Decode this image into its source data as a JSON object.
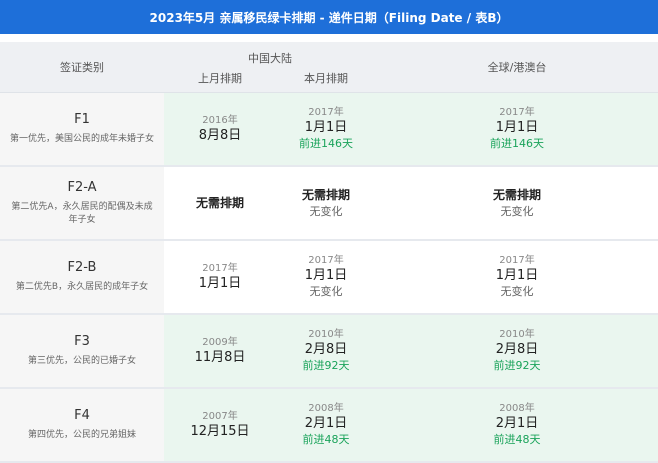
{
  "title": "2023年5月 亲属移民绿卡排期 - 递件日期（Filing Date / 表B）",
  "header": {
    "category": "签证类别",
    "mainland": "中国大陆",
    "last_month": "上月排期",
    "this_month": "本月排期",
    "global": "全球/港澳台"
  },
  "rows": [
    {
      "code": "F1",
      "desc": "第一优先，美国公民的成年未婚子女",
      "last": {
        "year": "2016年",
        "date": "8月8日"
      },
      "this": {
        "year": "2017年",
        "date": "1月1日",
        "note": "前进146天"
      },
      "global": {
        "year": "2017年",
        "date": "1月1日",
        "note": "前进146天"
      }
    },
    {
      "code": "F2-A",
      "desc": "第二优先A，永久居民的配偶及未成年子女",
      "last": {
        "main": "无需排期"
      },
      "this": {
        "main": "无需排期",
        "note": "无变化"
      },
      "global": {
        "main": "无需排期",
        "note": "无变化"
      }
    },
    {
      "code": "F2-B",
      "desc": "第二优先B，永久居民的成年子女",
      "last": {
        "year": "2017年",
        "date": "1月1日"
      },
      "this": {
        "year": "2017年",
        "date": "1月1日",
        "note": "无变化"
      },
      "global": {
        "year": "2017年",
        "date": "1月1日",
        "note": "无变化"
      }
    },
    {
      "code": "F3",
      "desc": "第三优先，公民的已婚子女",
      "last": {
        "year": "2009年",
        "date": "11月8日"
      },
      "this": {
        "year": "2010年",
        "date": "2月8日",
        "note": "前进92天"
      },
      "global": {
        "year": "2010年",
        "date": "2月8日",
        "note": "前进92天"
      }
    },
    {
      "code": "F4",
      "desc": "第四优先，公民的兄弟姐妹",
      "last": {
        "year": "2007年",
        "date": "12月15日"
      },
      "this": {
        "year": "2008年",
        "date": "2月1日",
        "note": "前进48天"
      },
      "global": {
        "year": "2008年",
        "date": "2月1日",
        "note": "前进48天"
      }
    }
  ],
  "colors": {
    "title_bg": "#1e6fd9",
    "advance": "#1aa35a",
    "row_green": "#eaf6ef"
  }
}
